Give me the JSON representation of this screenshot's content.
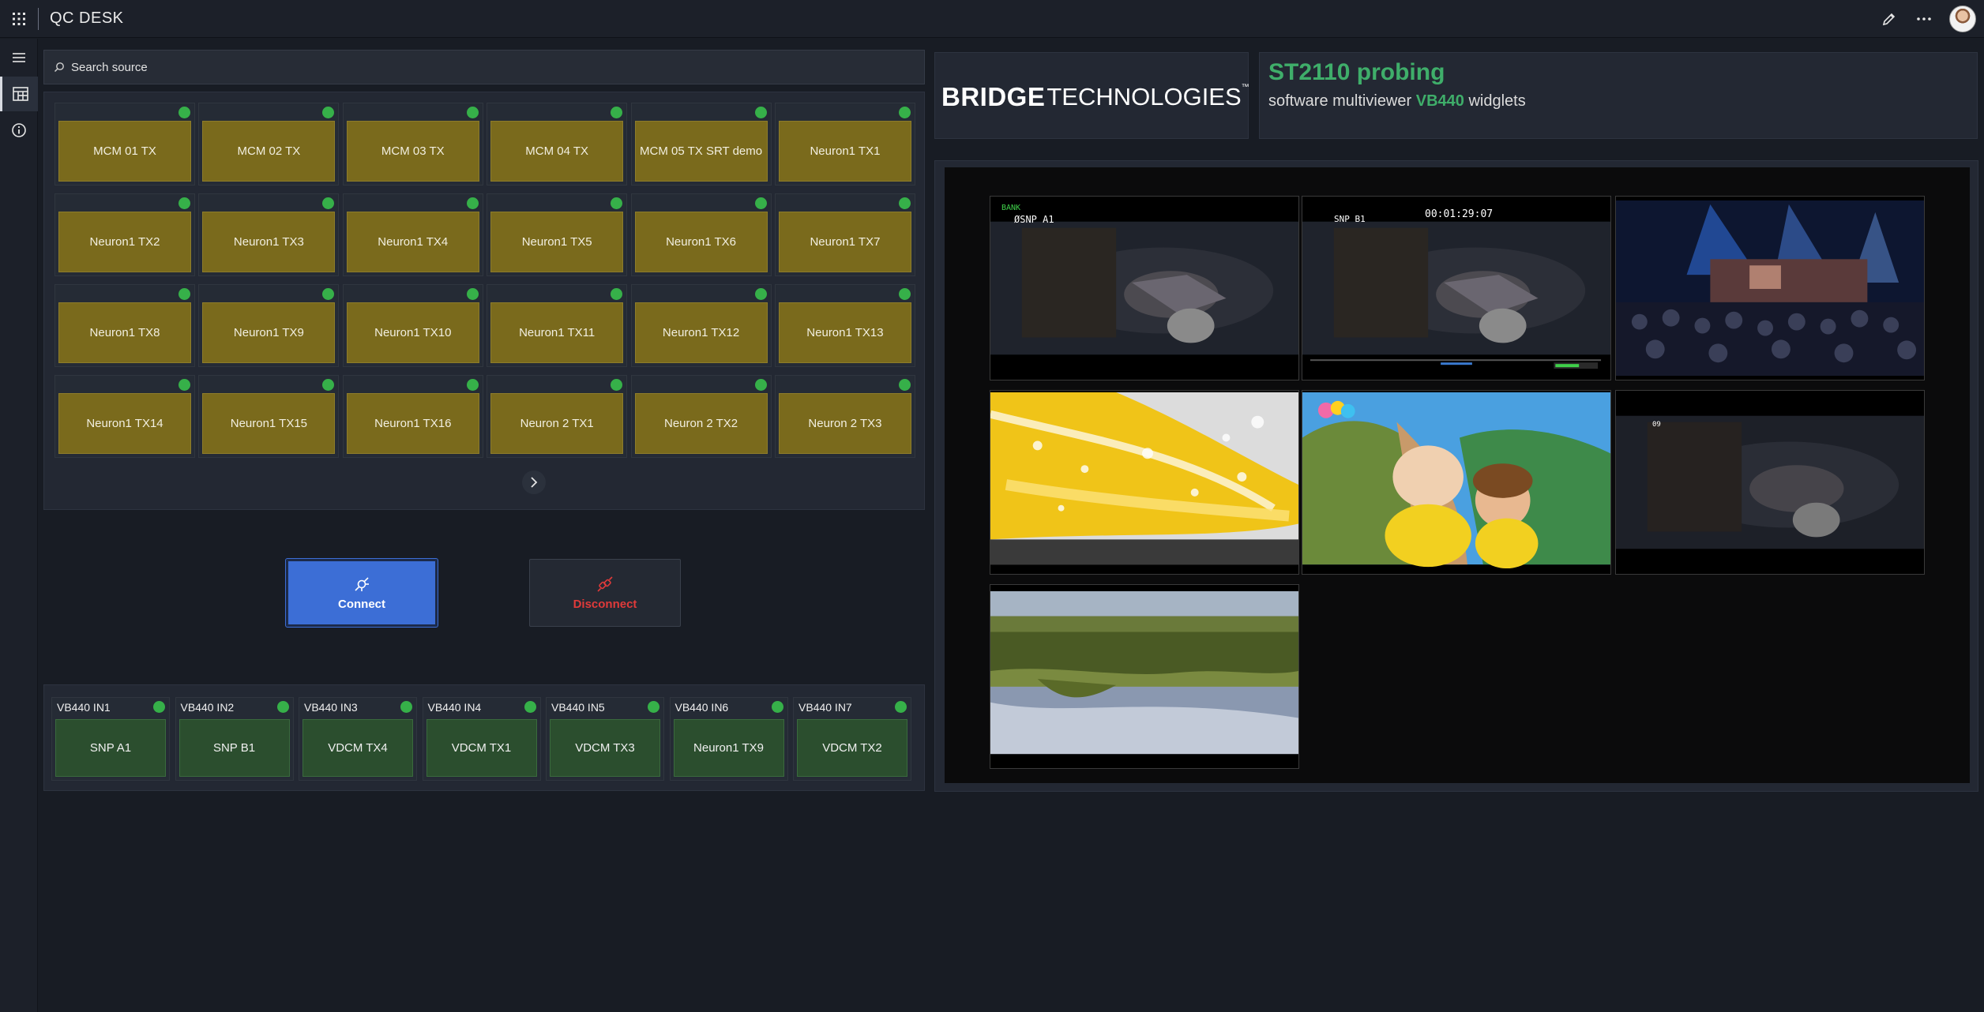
{
  "app": {
    "title": "QC DESK"
  },
  "topbar": {
    "icons": [
      "app-grid-icon",
      "pencil-icon",
      "more-icon",
      "avatar"
    ]
  },
  "leftrail": {
    "icons": [
      "hamburger-icon",
      "dashboard-icon",
      "info-icon"
    ]
  },
  "search": {
    "placeholder": "Search source",
    "value": ""
  },
  "sources": {
    "tiles": [
      "MCM 01 TX",
      "MCM 02 TX",
      "MCM 03 TX",
      "MCM 04 TX",
      "MCM 05 TX SRT demo",
      "Neuron1 TX1",
      "Neuron1 TX2",
      "Neuron1 TX3",
      "Neuron1 TX4",
      "Neuron1 TX5",
      "Neuron1 TX6",
      "Neuron1 TX7",
      "Neuron1 TX8",
      "Neuron1 TX9",
      "Neuron1 TX10",
      "Neuron1 TX11",
      "Neuron1 TX12",
      "Neuron1 TX13",
      "Neuron1 TX14",
      "Neuron1 TX15",
      "Neuron1 TX16",
      "Neuron 2 TX1",
      "Neuron 2 TX2",
      "Neuron 2 TX3"
    ],
    "status_color": "#36b049",
    "tile_color": "#7a6a1c"
  },
  "actions": {
    "connect_label": "Connect",
    "disconnect_label": "Disconnect"
  },
  "inputs": {
    "tiles": [
      {
        "label": "VB440 IN1",
        "source": "SNP A1"
      },
      {
        "label": "VB440 IN2",
        "source": "SNP B1"
      },
      {
        "label": "VB440 IN3",
        "source": "VDCM TX4"
      },
      {
        "label": "VB440 IN4",
        "source": "VDCM TX1"
      },
      {
        "label": "VB440 IN5",
        "source": "VDCM TX3"
      },
      {
        "label": "VB440 IN6",
        "source": "Neuron1 TX9"
      },
      {
        "label": "VB440 IN7",
        "source": "VDCM TX2"
      }
    ],
    "tile_color": "#2b4e2e"
  },
  "logo": {
    "bridge": "BRIDGE",
    "technologies": "TECHNOLOGIES",
    "tm": "™"
  },
  "header": {
    "title": "ST2110 probing",
    "subtitle_prefix": "software multiviewer",
    "subtitle_highlight": "VB440",
    "subtitle_suffix": "widglets",
    "accent_color": "#3fae6a"
  },
  "multiviewer": {
    "overlay_a_bank": "BANK",
    "overlay_a_label": "ØSNP A1",
    "overlay_b_label": "SNP B1",
    "overlay_b_timecode": "00:01:29:07",
    "overlay_f_label": "09"
  }
}
